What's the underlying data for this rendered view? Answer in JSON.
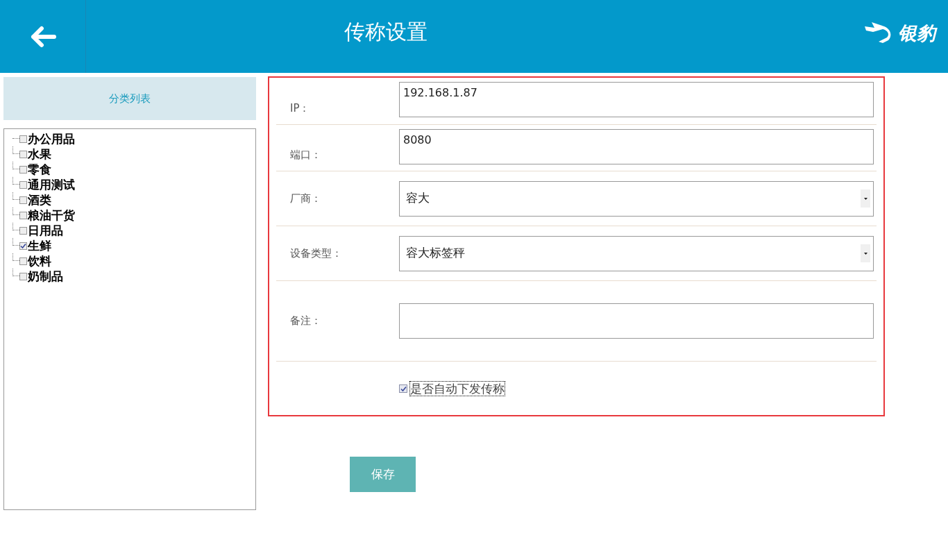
{
  "header": {
    "title": "传称设置",
    "logo_text": "银豹"
  },
  "sidebar": {
    "title": "分类列表",
    "items": [
      {
        "label": "办公用品",
        "checked": false
      },
      {
        "label": "水果",
        "checked": false
      },
      {
        "label": "零食",
        "checked": false
      },
      {
        "label": "通用测试",
        "checked": false
      },
      {
        "label": "酒类",
        "checked": false
      },
      {
        "label": "粮油干货",
        "checked": false
      },
      {
        "label": "日用品",
        "checked": false
      },
      {
        "label": "生鲜",
        "checked": true
      },
      {
        "label": "饮料",
        "checked": false
      },
      {
        "label": "奶制品",
        "checked": false
      }
    ]
  },
  "form": {
    "fields": [
      {
        "kind": "text",
        "label": "IP：",
        "value": "192.168.1.87"
      },
      {
        "kind": "text",
        "label": "端口：",
        "value": "8080"
      },
      {
        "kind": "select",
        "label": "厂商：",
        "value": "容大"
      },
      {
        "kind": "select",
        "label": "设备类型：",
        "value": "容大标签秤"
      },
      {
        "kind": "text",
        "label": "备注："
      },
      {
        "kind": "checkbox",
        "label": "是否自动下发传称",
        "checked": true
      }
    ]
  },
  "save_button": "保存"
}
